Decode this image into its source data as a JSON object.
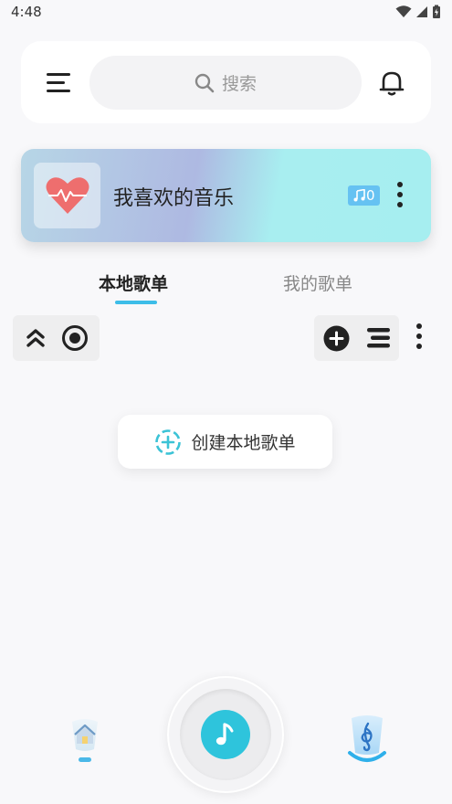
{
  "status_bar": {
    "time": "4:48"
  },
  "header": {
    "search_placeholder": "搜索",
    "icons": [
      "menu-icon",
      "search-icon",
      "bell-icon"
    ]
  },
  "favorites": {
    "title": "我喜欢的音乐",
    "count": "0",
    "icons": [
      "heart-icon",
      "music-note-icon",
      "more-vertical-icon"
    ]
  },
  "tabs": [
    {
      "label": "本地歌单",
      "active": true
    },
    {
      "label": "我的歌单",
      "active": false
    }
  ],
  "toolbar": {
    "left_icons": [
      "collapse-up-icon",
      "locate-icon"
    ],
    "right_icons": [
      "add-icon",
      "sort-icon",
      "more-vertical-icon"
    ]
  },
  "create_playlist": {
    "label": "创建本地歌单"
  },
  "bottom_nav": {
    "items": [
      "home-icon",
      "play-music-icon",
      "treble-clef-icon"
    ]
  },
  "colors": {
    "accent": "#2ec4dc",
    "tab_underline": "#3dbde8",
    "badge": "#66c2f2",
    "background": "#f8f8fa"
  }
}
